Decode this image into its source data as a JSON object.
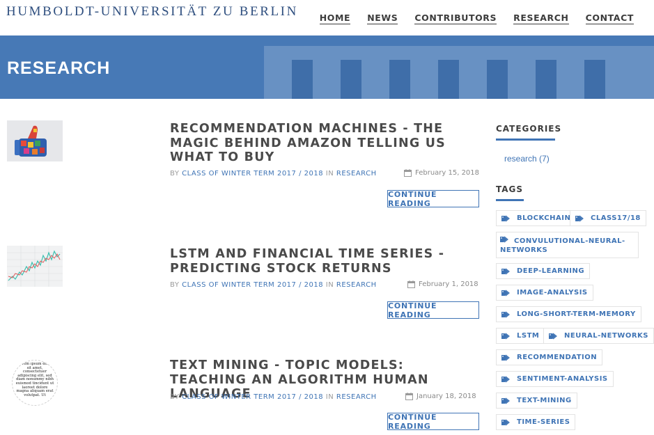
{
  "header": {
    "logo_text": "HUMBOLDT-UNIVERSITÄT ZU BERLIN",
    "nav": [
      {
        "label": "HOME"
      },
      {
        "label": "NEWS"
      },
      {
        "label": "CONTRIBUTORS"
      },
      {
        "label": "RESEARCH"
      },
      {
        "label": "CONTACT"
      }
    ]
  },
  "banner": {
    "title": "RESEARCH"
  },
  "posts": [
    {
      "title": "RECOMMENDATION MACHINES - THE MAGIC BEHIND AMAZON TELLING US WHAT TO BUY",
      "by": "BY",
      "author": "CLASS OF WINTER TERM 2017 / 2018",
      "in": "IN",
      "category": "RESEARCH",
      "date": "February 15, 2018",
      "cta": "CONTINUE READING"
    },
    {
      "title": "LSTM AND FINANCIAL TIME SERIES - PREDICTING STOCK RETURNS",
      "by": "BY",
      "author": "CLASS OF WINTER TERM 2017 / 2018",
      "in": "IN",
      "category": "RESEARCH",
      "date": "February 1, 2018",
      "cta": "CONTINUE READING"
    },
    {
      "title": "TEXT MINING - TOPIC MODELS: TEACHING AN ALGORITHM HUMAN LANGUAGE",
      "by": "BY",
      "author": "CLASS OF WINTER TERM 2017 / 2018",
      "in": "IN",
      "category": "RESEARCH",
      "date": "January 18, 2018",
      "cta": "CONTINUE READING",
      "thumb_text": "Lorem ipsum dolor sit amet, consectetuer adipiscing elit, sed diam nonummy nibh euismod tincidunt ut laoreet dolore magna aliquam erat volutpat. Ut"
    }
  ],
  "sidebar": {
    "categories_heading": "CATEGORIES",
    "categories": [
      {
        "label": "research (7)"
      }
    ],
    "tags_heading": "TAGS",
    "tags": [
      {
        "label": "BLOCKCHAIN"
      },
      {
        "label": "CLASS17/18"
      },
      {
        "label": "CONVULUTIONAL-NEURAL-NETWORKS"
      },
      {
        "label": "DEEP-LEARNING"
      },
      {
        "label": "IMAGE-ANALYSIS"
      },
      {
        "label": "LONG-SHORT-TERM-MEMORY"
      },
      {
        "label": "LSTM"
      },
      {
        "label": "NEURAL-NETWORKS"
      },
      {
        "label": "RECOMMENDATION"
      },
      {
        "label": "SENTIMENT-ANALYSIS"
      },
      {
        "label": "TEXT-MINING"
      },
      {
        "label": "TIME-SERIES"
      }
    ]
  },
  "colors": {
    "accent": "#3f74b5",
    "banner": "#4779b6",
    "logo": "#2f4f7f",
    "heading_text": "#4a4a4a"
  },
  "icons": {
    "tag": "tag-icon",
    "date": "calendar-icon"
  }
}
